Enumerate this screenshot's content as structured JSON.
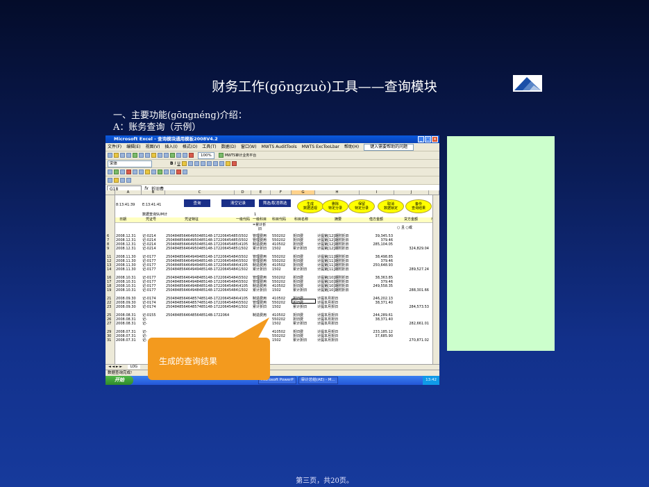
{
  "slide": {
    "title": "财务工作(gōngzuò)工具——查询模块",
    "subtitle1": "一、主要功能(gōngnéng)介绍：",
    "subtitle2": "A：账务查询（示例）",
    "callout": "生成的查询结果",
    "footer": "第三页，共20页。"
  },
  "excel": {
    "window_title": "Microsoft Excel - 查询模块通用模板2008V4.2",
    "menu": [
      "文件(F)",
      "编辑(E)",
      "视图(V)",
      "插入(I)",
      "格式(O)",
      "工具(T)",
      "数据(D)",
      "窗口(W)",
      "MWTS AuditTools",
      "MWTS ExcTooLbar",
      "帮助(H)"
    ],
    "help_box": "键入需要帮助的问题",
    "font_name": "宋体",
    "zoom": "100%",
    "plugin": "MWTS审计业务平台",
    "name_box": "G18",
    "formula": "折旧费",
    "columns": [
      "A",
      "B",
      "C",
      "D",
      "E",
      "F",
      "G",
      "H",
      "I",
      "J"
    ],
    "r2": {
      "a": "8:13:41:39",
      "b": "E:13:41:41"
    },
    "buttons_rect": [
      "查询",
      "清空记录",
      "筛选/取消筛选"
    ],
    "buttons_oval": [
      {
        "l1": "生成",
        "l2": "数据透视"
      },
      {
        "l1": "删除",
        "l2": "特定分录"
      },
      {
        "l1": "保留",
        "l2": "特定分录"
      },
      {
        "l1": "取消",
        "l2": "数据锁定"
      },
      {
        "l1": "备份",
        "l2": "查询结果"
      }
    ],
    "r3_label": "数据查询SUM计",
    "r3_val": "1",
    "headers": [
      "日期",
      "凭证号",
      "凭证特征",
      "一级代码",
      "一级科目",
      "科目代码",
      "科目名称",
      "摘要",
      "借方金额",
      "贷方金额",
      "币"
    ],
    "r4": {
      "sum": "=累计折",
      "sum2": "旧",
      "j": "○ 且 ○或"
    },
    "rows": [
      {
        "n": "6",
        "a": "2008.12.31",
        "b": "记-0214",
        "c": "250484856464950485148-17220645485\\5502",
        "e": "管理费用",
        "f": "550202",
        "g": "折旧费",
        "h": "计提第[12]期附折旧",
        "i": "39,345.53",
        "j": ""
      },
      {
        "n": "7",
        "a": "2008.12.31",
        "b": "记-0214",
        "c": "250484856464950485148-17220645485\\5502",
        "e": "管理费用",
        "f": "550202",
        "g": "折旧费",
        "h": "计提第[12]期附折旧",
        "i": "379.46",
        "j": ""
      },
      {
        "n": "8",
        "a": "2008.12.31",
        "b": "记-0214",
        "c": "250484856464950485148-17220645485\\4105",
        "e": "制造费用",
        "f": "410502",
        "g": "折旧费",
        "h": "计提第[12]期附折旧",
        "i": "285,104.05",
        "j": ""
      },
      {
        "n": "9",
        "a": "2008.12.31",
        "b": "记-0214",
        "c": "250484856464950485148-17220645485\\1502",
        "e": "累计折旧",
        "f": "1502",
        "g": "累计折旧",
        "h": "计提第[12]期附折旧",
        "i": "",
        "j": "324,829.04"
      },
      {
        "n": "11",
        "a": "2008.11.30",
        "b": "记-0177",
        "c": "250484856464949485148-17220645484\\5502",
        "e": "管理费用",
        "f": "550202",
        "g": "折旧费",
        "h": "计提第[11]期附折旧",
        "i": "38,498.85",
        "j": ""
      },
      {
        "n": "12",
        "a": "2008.11.30",
        "b": "记-0177",
        "c": "250484856464949485148-17220645484\\5502",
        "e": "管理费用",
        "f": "550202",
        "g": "折旧费",
        "h": "计提第[11]期附折旧",
        "i": "379.46",
        "j": ""
      },
      {
        "n": "13",
        "a": "2008.11.30",
        "b": "记-0177",
        "c": "250484856464949485148-17220645484\\4105",
        "e": "制造费用",
        "f": "410502",
        "g": "折旧费",
        "h": "计提第[11]期附折旧",
        "i": "250,648.93",
        "j": ""
      },
      {
        "n": "14",
        "a": "2008.11.30",
        "b": "记-0177",
        "c": "250484856464949485148-17220645484\\1502",
        "e": "累计折旧",
        "f": "1502",
        "g": "累计折旧",
        "h": "计提第[11]期附折旧",
        "i": "",
        "j": "289,527.24"
      },
      {
        "n": "16",
        "a": "2008.10.31",
        "b": "记-0177",
        "c": "250484856464948485148-17220645484\\5502",
        "e": "管理费用",
        "f": "550202",
        "g": "折旧费",
        "h": "计提第[10]期附折旧",
        "i": "38,363.85",
        "j": ""
      },
      {
        "n": "17",
        "a": "2008.10.31",
        "b": "记-0177",
        "c": "250484856464948485148-17220645484\\5502",
        "e": "管理费用",
        "f": "550202",
        "g": "折旧费",
        "h": "计提第[10]期附折旧",
        "i": "379.46",
        "j": ""
      },
      {
        "n": "18",
        "a": "2008.10.31",
        "b": "记-0177",
        "c": "250484856464948485148-17220645484\\4105",
        "e": "制造费用",
        "f": "410502",
        "g": "折旧费",
        "h": "计提第[10]期附折旧",
        "i": "249,558.35",
        "j": ""
      },
      {
        "n": "19",
        "a": "2008.10.31",
        "b": "记-0177",
        "c": "250484856464948485148-17220645484\\1502",
        "e": "累计折旧",
        "f": "1502",
        "g": "累计折旧",
        "h": "计提第[10]期附折旧",
        "i": "",
        "j": "288,301.66"
      },
      {
        "n": "21",
        "a": "2008.09.30",
        "b": "记-0174",
        "c": "250484856464857485148-17220645484\\4105",
        "e": "制造费用",
        "f": "410502",
        "g": "折旧费",
        "h": "计提本月折旧",
        "i": "246,202.13",
        "j": ""
      },
      {
        "n": "22",
        "a": "2008.09.30",
        "b": "记-0174",
        "c": "250484856464857485148-17220645484\\5502",
        "e": "管理费用",
        "f": "550202",
        "g": "折旧费",
        "h": "计提本月折旧",
        "i": "38,371.40",
        "j": ""
      },
      {
        "n": "23",
        "a": "2008.09.30",
        "b": "记-0174",
        "c": "250484856464857485148-17220645484\\1502",
        "e": "累计折旧",
        "f": "1502",
        "g": "累计折旧",
        "h": "计提本月折旧",
        "i": "",
        "j": "284,573.53"
      },
      {
        "n": "25",
        "a": "2008.08.31",
        "b": "记-0155",
        "c": "25048485646485648514B-1722064",
        "e": "制造费用",
        "f": "410502",
        "g": "折旧费",
        "h": "计提本月折旧",
        "i": "244,289.61",
        "j": ""
      },
      {
        "n": "26",
        "a": "2008.08.31",
        "b": "记-",
        "c": "",
        "e": "",
        "f": "550202",
        "g": "折旧费",
        "h": "计提本月折旧",
        "i": "38,371.40",
        "j": ""
      },
      {
        "n": "27",
        "a": "2008.08.31",
        "b": "记-",
        "c": "",
        "e": "",
        "f": "1502",
        "g": "累计折旧",
        "h": "计提本月折旧",
        "i": "",
        "j": "282,661.01"
      },
      {
        "n": "29",
        "a": "2008.07.31",
        "b": "记-",
        "c": "",
        "e": "",
        "f": "410502",
        "g": "折旧费",
        "h": "计提本月折旧",
        "i": "233,185.12",
        "j": ""
      },
      {
        "n": "30",
        "a": "2008.07.31",
        "b": "记-",
        "c": "",
        "e": "",
        "f": "550202",
        "g": "折旧费",
        "h": "计提本月折旧",
        "i": "37,685.90",
        "j": ""
      },
      {
        "n": "31",
        "a": "2008.07.31",
        "b": "记-",
        "c": "",
        "e": "",
        "f": "1502",
        "g": "累计折旧",
        "h": "计提本月折旧",
        "i": "",
        "j": "270,871.02"
      }
    ],
    "sheet_tab": "LOG",
    "status": "数据查询完成!",
    "taskbar": {
      "start": "开始",
      "tasks": [
        "Microsoft PowerP",
        "审计总结(AE) - M..."
      ],
      "clock": "13:42"
    }
  }
}
